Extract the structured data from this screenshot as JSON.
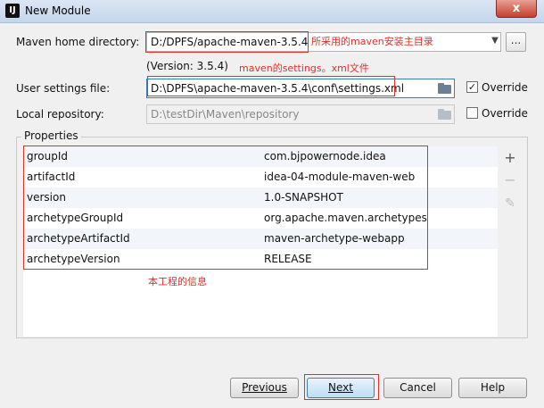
{
  "window": {
    "title": "New Module",
    "icon_text": "IJ",
    "close_glyph": "x"
  },
  "form": {
    "maven_home_label": "Maven home directory:",
    "maven_home_value": "D:/DPFS/apache-maven-3.5.4",
    "maven_version": "(Version: 3.5.4)",
    "user_settings_label": "User settings file:",
    "user_settings_value": "D:\\DPFS\\apache-maven-3.5.4\\conf\\settings.xml",
    "user_settings_override_label": "Override",
    "user_settings_override_checked": true,
    "local_repo_label": "Local repository:",
    "local_repo_value": "D:\\testDir\\Maven\\repository",
    "local_repo_override_label": "Override",
    "local_repo_override_checked": false,
    "browse_glyph": "..."
  },
  "annotations": {
    "maven_home_note": "所采用的maven安装主目录",
    "settings_note": "maven的settings。xml文件",
    "project_note": "本工程的信息"
  },
  "properties": {
    "group_title": "Properties",
    "rows": [
      {
        "key": "groupId",
        "value": "com.bjpowernode.idea"
      },
      {
        "key": "artifactId",
        "value": "idea-04-module-maven-web"
      },
      {
        "key": "version",
        "value": "1.0-SNAPSHOT"
      },
      {
        "key": "archetypeGroupId",
        "value": "org.apache.maven.archetypes"
      },
      {
        "key": "archetypeArtifactId",
        "value": "maven-archetype-webapp"
      },
      {
        "key": "archetypeVersion",
        "value": "RELEASE"
      }
    ],
    "tools": {
      "add": "+",
      "remove": "−",
      "edit": "✎"
    }
  },
  "buttons": {
    "previous": "Previous",
    "next": "Next",
    "cancel": "Cancel",
    "help": "Help"
  },
  "colors": {
    "annotation_red": "#e0302a",
    "primary_button": "#3c7fb1"
  },
  "icons": {
    "dropdown": "chevron-down-icon",
    "folder": "folder-icon",
    "check": "check-icon"
  }
}
